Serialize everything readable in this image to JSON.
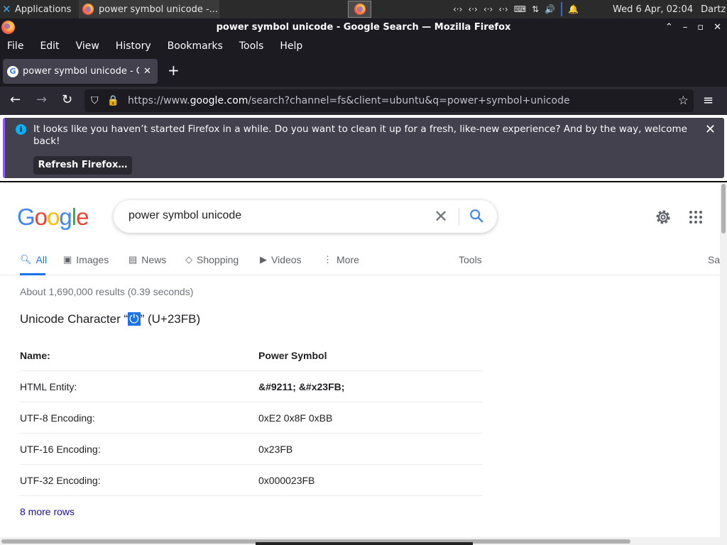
{
  "taskbar": {
    "apps_label": "Applications",
    "task_title": "power symbol unicode -...",
    "clock": "Wed  6 Apr, 02:04",
    "user": "Dartz"
  },
  "window": {
    "title": "power symbol unicode - Google Search — Mozilla Firefox"
  },
  "menu": [
    "File",
    "Edit",
    "View",
    "History",
    "Bookmarks",
    "Tools",
    "Help"
  ],
  "tab": {
    "title": "power symbol unicode - G"
  },
  "urlbar": {
    "prefix": "https://www.",
    "domain": "google.com",
    "suffix": "/search?channel=fs&client=ubuntu&q=power+symbol+unicode"
  },
  "notification": {
    "message": "It looks like you haven’t started Firefox in a while. Do you want to clean it up for a fresh, like-new experience? And by the way, welcome back!",
    "button": "Refresh Firefox…"
  },
  "google": {
    "query": "power symbol unicode",
    "tabs": [
      {
        "label": "All",
        "icon": "search-icon"
      },
      {
        "label": "Images",
        "icon": "image-icon"
      },
      {
        "label": "News",
        "icon": "news-icon"
      },
      {
        "label": "Shopping",
        "icon": "tag-icon"
      },
      {
        "label": "Videos",
        "icon": "play-icon"
      },
      {
        "label": "More",
        "icon": "more-dots-icon"
      }
    ],
    "tools": "Tools",
    "safesearch_partial": "Sa",
    "stats": "About 1,690,000 results (0.39 seconds)",
    "title_prefix": "Unicode Character “",
    "title_symbol": "⏻",
    "title_suffix": "” (U+23FB)",
    "rows": [
      {
        "key": "Name:",
        "value": "Power Symbol"
      },
      {
        "key": "HTML Entity:",
        "value": "&#9211; &#x23FB;"
      },
      {
        "key": "UTF-8 Encoding:",
        "value": "0xE2 0x8F 0xBB"
      },
      {
        "key": "UTF-16 Encoding:",
        "value": "0x23FB"
      },
      {
        "key": "UTF-32 Encoding:",
        "value": "0x000023FB"
      }
    ],
    "more_rows": "8 more rows",
    "accent": "#1a73e8"
  }
}
